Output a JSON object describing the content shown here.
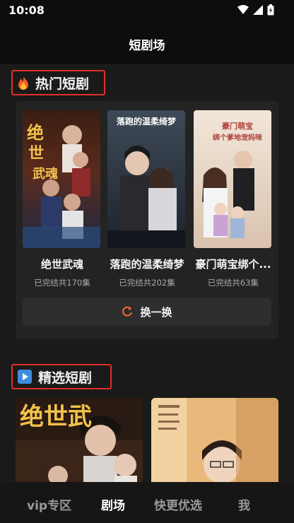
{
  "status_bar": {
    "time": "10:08"
  },
  "header": {
    "title": "短剧场"
  },
  "hot_section": {
    "title": "热门短剧",
    "icon": "fire-icon",
    "dramas": [
      {
        "title": "绝世武魂",
        "status": "已完结共170集",
        "poster_text": "绝世武魂"
      },
      {
        "title": "落跑的温柔绮梦",
        "status": "已完结共202集",
        "poster_text": "落跑的温柔绮梦"
      },
      {
        "title": "豪门萌宝绑个...",
        "status": "已完结共63集",
        "poster_text": "豪门萌宝绑个爹地宠妈咪"
      }
    ],
    "swap_label": "换一换"
  },
  "selected_section": {
    "title": "精选短剧",
    "icon": "play-icon",
    "poster_texts": [
      "绝世武",
      ""
    ]
  },
  "bottom_nav": {
    "items": [
      {
        "label": "vip专区"
      },
      {
        "label": "剧场"
      },
      {
        "label": "快更优选"
      },
      {
        "label": "我"
      }
    ],
    "active_index": 1
  },
  "colors": {
    "highlight_border": "#e0302a",
    "swap_icon": "#ff6a2a"
  }
}
